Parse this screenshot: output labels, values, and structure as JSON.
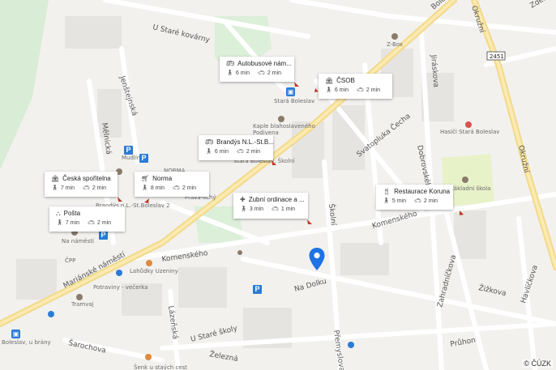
{
  "map": {
    "copyright": "© ČÚZK",
    "road_badge": "2451",
    "street_labels": {
      "u_stare_kovarny": "U Staré kovárny",
      "boleslav": "Boleslav",
      "jirsikova": "Jiráskova",
      "okruzni_top": "Okružní",
      "okruzni_right": "Okružní",
      "jenstejnova": "Jenštejnská",
      "melnicka": "Mělnická",
      "svatopluka_cecha": "Svatopluka Čecha",
      "dobrovskeho": "Dobrovského",
      "skolni": "Školní",
      "komenskeho_right": "Komenského",
      "komenskeho_left": "Komenského",
      "marianske_namesti": "Mariánské náměstí",
      "na_dolku": "Na Dolku",
      "zahradnickova": "Zahradníčkova",
      "havlickova": "Havlíčkova",
      "zizkova": "Žižkova",
      "pruhon": "Průhon",
      "u_stare_skoly": "U Staré školy",
      "zelezna": "Železná",
      "lazenska": "Lázeňská",
      "premyslova": "Přemyslova",
      "sarochova": "Šarochova",
      "zdenka": "Zdeň"
    },
    "poi_labels": {
      "zbox": "Z-Box",
      "stara_boleslav": "Stará Boleslav",
      "kaple": "Kaple blahoslaveného\nPodivena",
      "hasici": "Hasiči Stará Boleslav",
      "zakladni_skola": "Základní škola",
      "norma_small": "NORMA",
      "prava_lichy": "Pravá-lichý",
      "brandys_labem": "Brandýs n.L.-St.Boleslav 2",
      "na_namesti": "Na náměstí",
      "cpp": "ČPP",
      "lahudky": "Lahůdky Uzeniny",
      "potraviny": "Potraviny - večerka",
      "tramvaj": "Tramvaj",
      "boleslav_u_brany": "Boleslav, u brány",
      "sank": "Šenk u staých cest",
      "boleslav_skolni": "Stará Boleslav, Školní",
      "mudlin": "Mudlín"
    }
  },
  "cards": [
    {
      "id": "autobusove",
      "title": "Autobusové nám...",
      "icon": "bus-icon",
      "walk": "6 min",
      "car": "2 min"
    },
    {
      "id": "csob",
      "title": "ČSOB",
      "icon": "bank-icon",
      "walk": "6 min",
      "car": "2 min"
    },
    {
      "id": "brandys",
      "title": "Brandýs N.L.-St.B...",
      "icon": "bus-icon",
      "walk": "6 min",
      "car": "2 min"
    },
    {
      "id": "ceska",
      "title": "Česká spořitelna",
      "icon": "bank-icon",
      "walk": "7 min",
      "car": "2 min"
    },
    {
      "id": "norma",
      "title": "Norma",
      "icon": "cart-icon",
      "walk": "8 min",
      "car": "2 min"
    },
    {
      "id": "zubni",
      "title": "Zubní ordinace a ...",
      "icon": "medical-icon",
      "walk": "3 min",
      "car": "1 min"
    },
    {
      "id": "posta",
      "title": "Pošta",
      "icon": "post-icon",
      "walk": "7 min",
      "car": "2 min"
    },
    {
      "id": "koruna",
      "title": "Restaurace Koruna",
      "icon": "restaurant-icon",
      "walk": "5 min",
      "car": "2 min"
    }
  ]
}
